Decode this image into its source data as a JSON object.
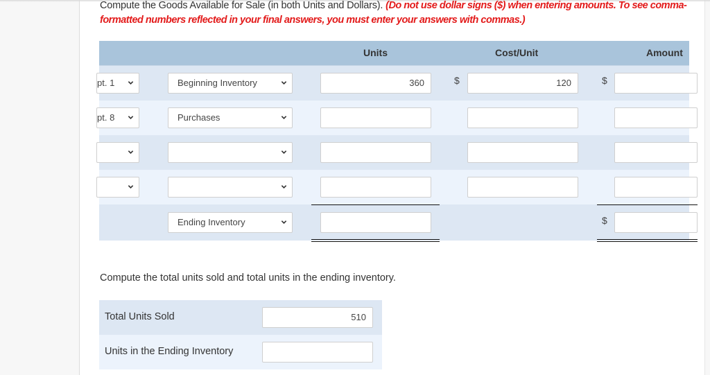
{
  "instructions": {
    "main": "Compute the Goods Available for Sale (in both Units and Dollars).",
    "warning": "(Do not use dollar signs ($) when entering amounts. To see comma-formatted numbers reflected in your final answers, you must enter your answers with commas.)"
  },
  "table": {
    "headers": {
      "units": "Units",
      "cost_unit": "Cost/Unit",
      "amount": "Amount"
    },
    "currency_symbol": "$",
    "rows": [
      {
        "date": "pt. 1",
        "description": "Beginning Inventory",
        "units": "360",
        "cost_unit": "120",
        "amount": "",
        "show_dollar": true
      },
      {
        "date": "pt. 8",
        "description": "Purchases",
        "units": "",
        "cost_unit": "",
        "amount": "",
        "show_dollar": false
      },
      {
        "date": "",
        "description": "",
        "units": "",
        "cost_unit": "",
        "amount": "",
        "show_dollar": false
      },
      {
        "date": "",
        "description": "",
        "units": "",
        "cost_unit": "",
        "amount": "",
        "show_dollar": false
      }
    ],
    "total_row": {
      "description": "Ending Inventory",
      "units": "",
      "amount": ""
    }
  },
  "units_section": {
    "instruction": "Compute the total units sold and total units in the ending inventory.",
    "rows": [
      {
        "label": "Total Units Sold",
        "value": "510"
      },
      {
        "label": "Units in the Ending Inventory",
        "value": ""
      }
    ]
  },
  "colors": {
    "header_bg": "#a9c4db",
    "row_odd": "#dde7f3",
    "row_even": "#ecf3fc",
    "warning": "#e31b1b"
  }
}
